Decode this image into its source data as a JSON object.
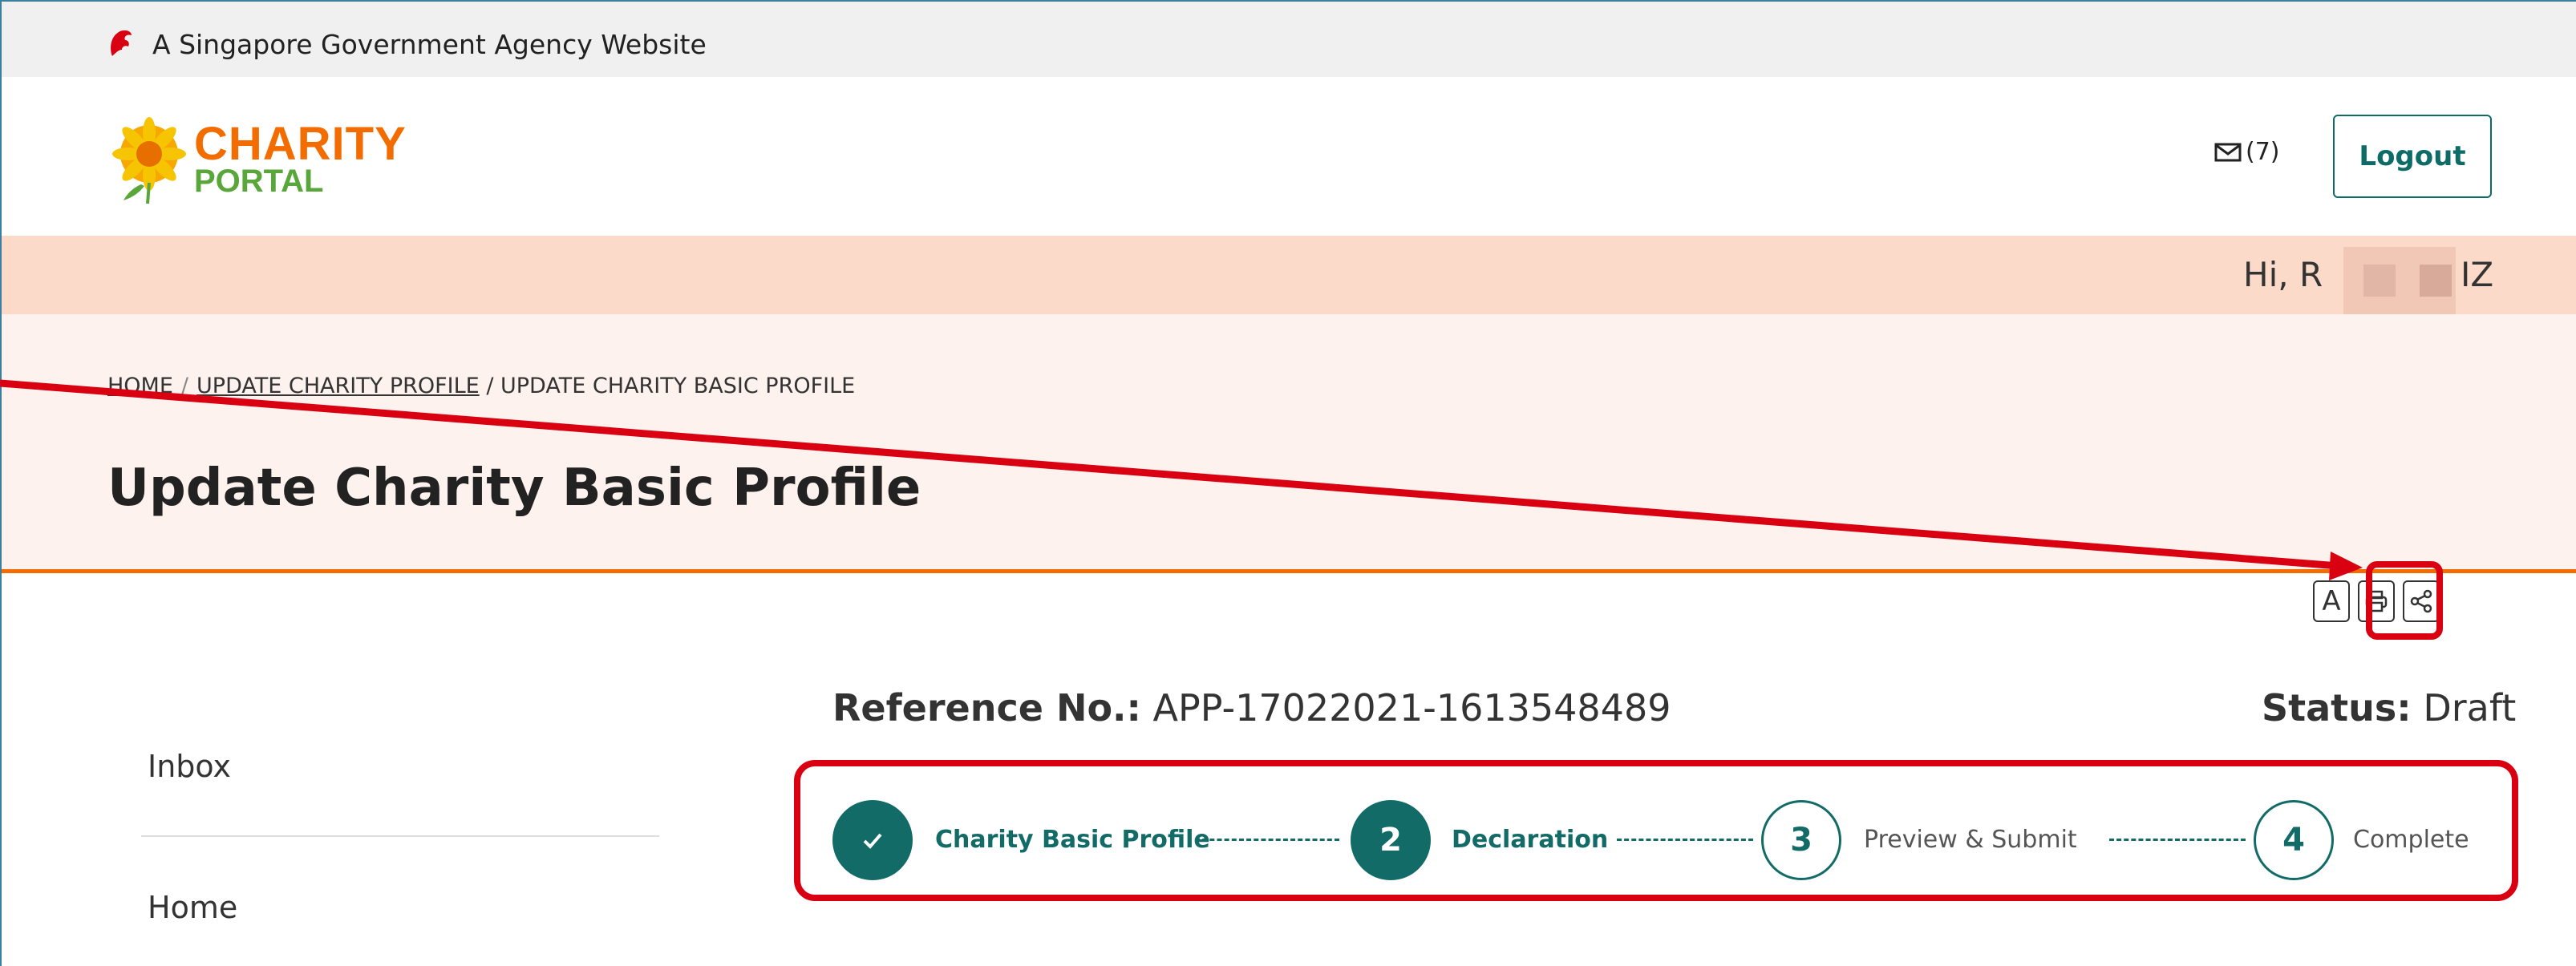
{
  "masthead": {
    "text": "A Singapore Government Agency Website",
    "icon": "lion-head-icon"
  },
  "header": {
    "logo_line1": "CHARITY",
    "logo_line2": "PORTAL",
    "mail_count": "(7)",
    "logout_label": "Logout"
  },
  "greeting": {
    "prefix": "Hi, R",
    "suffix": "IZ"
  },
  "breadcrumb": {
    "home": "HOME",
    "sep": "/",
    "update_profile": "UPDATE CHARITY PROFILE",
    "current": "/ UPDATE CHARITY BASIC PROFILE"
  },
  "page_title": "Update Charity Basic Profile",
  "tools": {
    "font_label": "A",
    "print_icon": "printer-icon",
    "share_icon": "share-icon"
  },
  "sidebar": {
    "items": [
      {
        "label": "Inbox"
      },
      {
        "label": "Home"
      }
    ]
  },
  "reference": {
    "label": "Reference No.:",
    "value": "APP-17022021-1613548489"
  },
  "status": {
    "label": "Status:",
    "value": "Draft"
  },
  "steps": [
    {
      "number": "",
      "label": "Charity Basic Profile",
      "state": "done"
    },
    {
      "number": "2",
      "label": "Declaration",
      "state": "current"
    },
    {
      "number": "3",
      "label": "Preview & Submit",
      "state": "todo"
    },
    {
      "number": "4",
      "label": "Complete",
      "state": "todo"
    }
  ],
  "colors": {
    "accent": "#126b66",
    "brand_orange": "#f36c00",
    "annotation_red": "#d90012"
  }
}
